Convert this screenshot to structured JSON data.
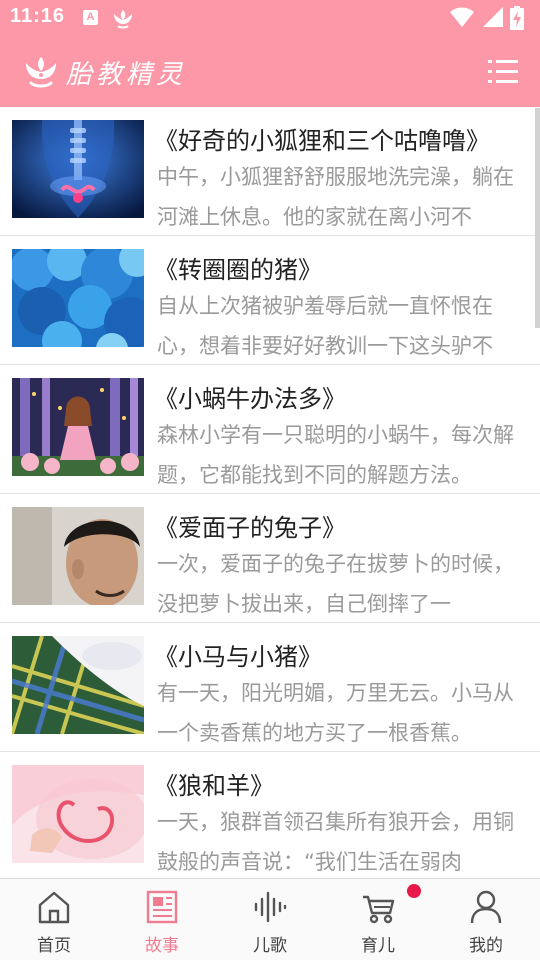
{
  "status_bar": {
    "time": "11:16",
    "notification_icons": [
      "a-icon",
      "lotus-icon"
    ],
    "system_icons": [
      "wifi-icon",
      "signal-icon",
      "battery-charging-icon"
    ],
    "background": "#fd98a8"
  },
  "header": {
    "title": "胎教精灵",
    "logo_icon": "lotus-hands-icon",
    "menu_icon": "list-menu-icon"
  },
  "stories": [
    {
      "title": "《好奇的小狐狸和三个咕噜噜》",
      "excerpt": "中午，小狐狸舒舒服服地洗完澡，躺在河滩上休息。他的家就在离小河不",
      "thumb": "anatomy-image"
    },
    {
      "title": "《转圈圈的猪》",
      "excerpt": "自从上次猪被驴羞辱后就一直怀恨在心，想着非要好好教训一下这头驴不",
      "thumb": "blue-clouds-image"
    },
    {
      "title": "《小蜗牛办法多》",
      "excerpt": "森林小学有一只聪明的小蜗牛，每次解题，它都能找到不同的解题方法。",
      "thumb": "forest-girl-illustration"
    },
    {
      "title": "《爱面子的兔子》",
      "excerpt": "一次，爱面子的兔子在拔萝卜的时候，没把萝卜拔出来，自己倒摔了一",
      "thumb": "man-portrait-photo"
    },
    {
      "title": "《小马与小猪》",
      "excerpt": "有一天，阳光明媚，万里无云。小马从一个卖香蕉的地方买了一根香蕉。",
      "thumb": "picnic-blanket-photo"
    },
    {
      "title": "《狼和羊》",
      "excerpt": "一天，狼群首领召集所有狼开会，用铜鼓般的声音说：“我们生活在弱肉",
      "thumb": "pregnant-belly-photo"
    }
  ],
  "bottom_nav": [
    {
      "label": "首页",
      "icon": "home-icon",
      "active": false
    },
    {
      "label": "故事",
      "icon": "news-icon",
      "active": true
    },
    {
      "label": "儿歌",
      "icon": "soundwave-icon",
      "active": false
    },
    {
      "label": "育儿",
      "icon": "stroller-icon",
      "active": false,
      "badge": true
    },
    {
      "label": "我的",
      "icon": "user-icon",
      "active": false
    }
  ],
  "colors": {
    "accent": "#fd98a8",
    "active_tab": "#f07c92",
    "badge": "#e8194b"
  }
}
